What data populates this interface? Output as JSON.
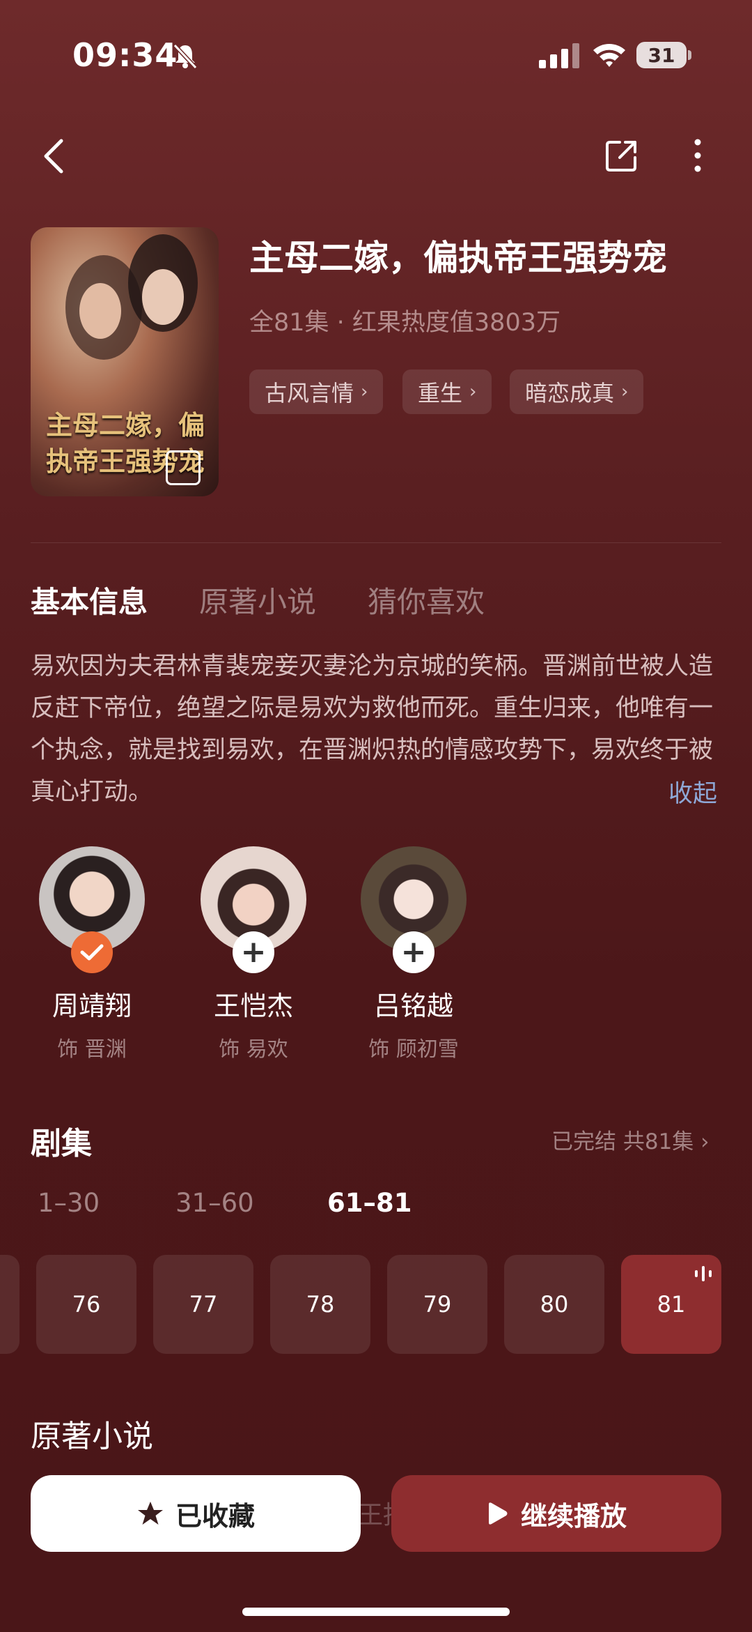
{
  "status_bar": {
    "time": "09:34",
    "battery": "31"
  },
  "show": {
    "title": "主母二嫁，偏执帝王强势宠",
    "meta": "全81集 · 红果热度值3803万",
    "tags": [
      "古风言情",
      "重生",
      "暗恋成真"
    ],
    "cover_title": "主母二嫁，偏执帝王强势宠"
  },
  "tabs": [
    "基本信息",
    "原著小说",
    "猜你喜欢"
  ],
  "description": "易欢因为夫君林青裴宠妾灭妻沦为京城的笑柄。晋渊前世被人造反赶下帝位，绝望之际是易欢为救他而死。重生归来，他唯有一个执念，就是找到易欢，在晋渊炽热的情感攻势下，易欢终于被真心打动。",
  "collapse_label": "收起",
  "cast": [
    {
      "name": "周靖翔",
      "role": "饰 晋渊",
      "followed": true
    },
    {
      "name": "王恺杰",
      "role": "饰 易欢",
      "followed": false
    },
    {
      "name": "吕铭越",
      "role": "饰 顾初雪",
      "followed": false
    }
  ],
  "episodes": {
    "section_title": "剧集",
    "status": "已完结 共81集",
    "ranges": [
      "1–30",
      "31–60",
      "61–81"
    ],
    "active_range": "61–81",
    "items": [
      "76",
      "77",
      "78",
      "79",
      "80",
      "81"
    ],
    "current": "81"
  },
  "novel_section_title": "原著小说",
  "ghost_text": "王拐",
  "buttons": {
    "favorite": "已收藏",
    "play": "继续播放"
  },
  "colors": {
    "accent": "#8e2d2f",
    "follow_badge": "#ee6b35",
    "link": "#8ea8d7"
  }
}
